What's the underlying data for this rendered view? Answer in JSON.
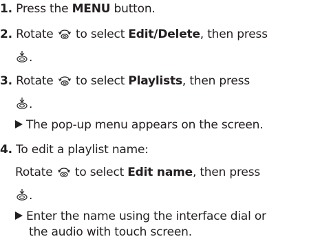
{
  "steps": [
    {
      "number": "1.",
      "pre": "Press the ",
      "bold": "MENU",
      "post": " button."
    },
    {
      "number": "2.",
      "pre": "Rotate ",
      "mid": " to select ",
      "bold": "Edit/Delete",
      "post": ", then press",
      "end": "."
    },
    {
      "number": "3.",
      "pre": "Rotate ",
      "mid": " to select ",
      "bold": "Playlists",
      "post": ", then press",
      "end": ".",
      "result": "The pop-up menu appears on the screen."
    },
    {
      "number": "4.",
      "intro": "To edit a playlist name:",
      "pre": "Rotate ",
      "mid": " to select ",
      "bold": "Edit name",
      "post": ", then press",
      "end": ".",
      "result_line1": "Enter the name using the interface dial or",
      "result_line2": "the audio with touch screen."
    }
  ],
  "icons": {
    "rotate": "rotate-dial-icon",
    "press": "press-dial-icon",
    "result_marker": "triangle-right-icon"
  },
  "colors": {
    "text": "#231f20"
  }
}
